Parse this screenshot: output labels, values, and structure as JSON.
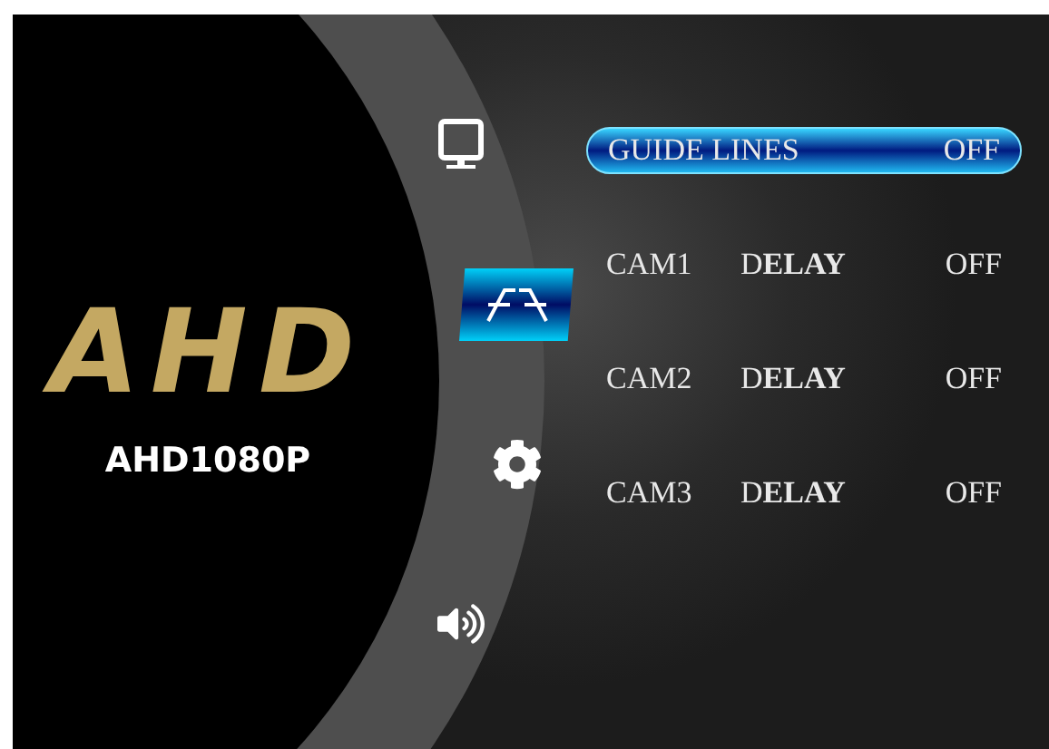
{
  "logo": {
    "brand": "AHD",
    "model": "AHD1080P"
  },
  "menu_icons": [
    {
      "kind": "display",
      "selected": false
    },
    {
      "kind": "guide",
      "selected": true
    },
    {
      "kind": "settings",
      "selected": false
    },
    {
      "kind": "sound",
      "selected": false
    }
  ],
  "rows": [
    {
      "label": "GUIDE LINES",
      "value": "OFF",
      "selected": true
    },
    {
      "label": "CAM1",
      "setting": "D**ELAY**",
      "value": "OFF",
      "selected": false
    },
    {
      "label": "CAM2",
      "setting": "D**ELAY**",
      "value": "OFF",
      "selected": false
    },
    {
      "label": "CAM3",
      "setting": "D**ELAY**",
      "value": "OFF",
      "selected": false
    }
  ]
}
